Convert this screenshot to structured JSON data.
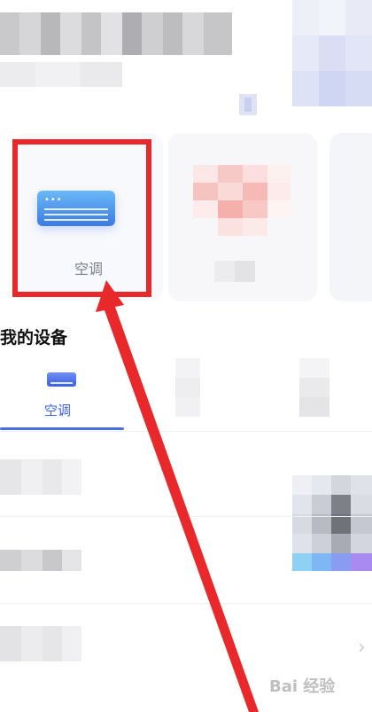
{
  "device_cards": [
    {
      "label": "空调"
    },
    {
      "label": ""
    },
    {
      "label": ""
    }
  ],
  "section_title": "我的设备",
  "tabs": [
    {
      "label": "空调",
      "active": true
    }
  ],
  "colors": {
    "accent": "#3d63e6",
    "highlight": "#e8282a",
    "ac_icon_top": "#6ab8f7",
    "ac_icon_bottom": "#3c7be4"
  },
  "watermark": "Bai 经验"
}
